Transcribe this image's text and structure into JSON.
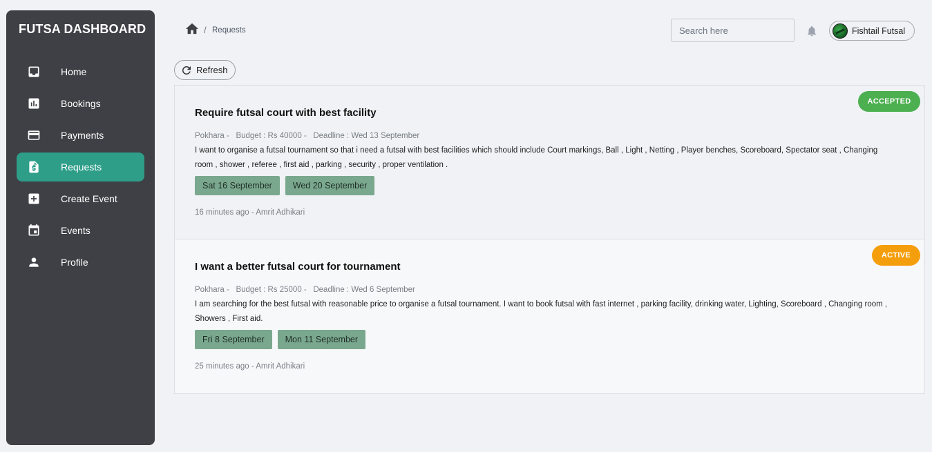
{
  "sidebar": {
    "brand": "FUTSA DASHBOARD",
    "items": [
      {
        "label": "Home",
        "icon": "inbox-icon"
      },
      {
        "label": "Bookings",
        "icon": "bar-chart-icon"
      },
      {
        "label": "Payments",
        "icon": "credit-card-icon"
      },
      {
        "label": "Requests",
        "icon": "money-document-icon",
        "active": true
      },
      {
        "label": "Create Event",
        "icon": "add-box-icon"
      },
      {
        "label": "Events",
        "icon": "calendar-icon"
      },
      {
        "label": "Profile",
        "icon": "person-icon"
      }
    ]
  },
  "header": {
    "breadcrumb_current": "Requests",
    "search_placeholder": "Search here",
    "profile_name": "Fishtail Futsal"
  },
  "toolbar": {
    "refresh_label": "Refresh"
  },
  "requests": [
    {
      "status": "ACCEPTED",
      "status_color": "#4caf50",
      "title": "Require futsal court with best facility",
      "location": "Pokhara -",
      "budget": "Budget : Rs 40000 -",
      "deadline": "Deadline : Wed 13 September",
      "description": "I want to organise a futsal tournament so that i need a futsal with best facilities which should include Court markings, Ball , Light , Netting , Player benches, Scoreboard, Spectator seat , Changing room , shower , referee , first aid , parking , security , proper ventilation .",
      "dates": [
        "Sat 16 September",
        "Wed 20 September"
      ],
      "footer": "16 minutes ago - Amrit Adhikari"
    },
    {
      "status": "ACTIVE",
      "status_color": "#f59e0b",
      "title": "I want a better futsal court for tournament",
      "location": "Pokhara -",
      "budget": "Budget : Rs 25000 -",
      "deadline": "Deadline : Wed 6 September",
      "description": "I am searching for the best futsal with reasonable price to organise a futsal tournament. I want to book futsal with fast internet , parking facility, drinking water, Lighting, Scoreboard , Changing room , Showers , First aid.",
      "dates": [
        "Fri 8 September",
        "Mon 11 September"
      ],
      "footer": "25 minutes ago - Amrit Adhikari"
    }
  ],
  "colors": {
    "sidebar_bg": "#3f3f46",
    "active_nav": "#2e9e89",
    "date_chip": "#7aa88e",
    "page_bg": "#f0f2f5"
  }
}
